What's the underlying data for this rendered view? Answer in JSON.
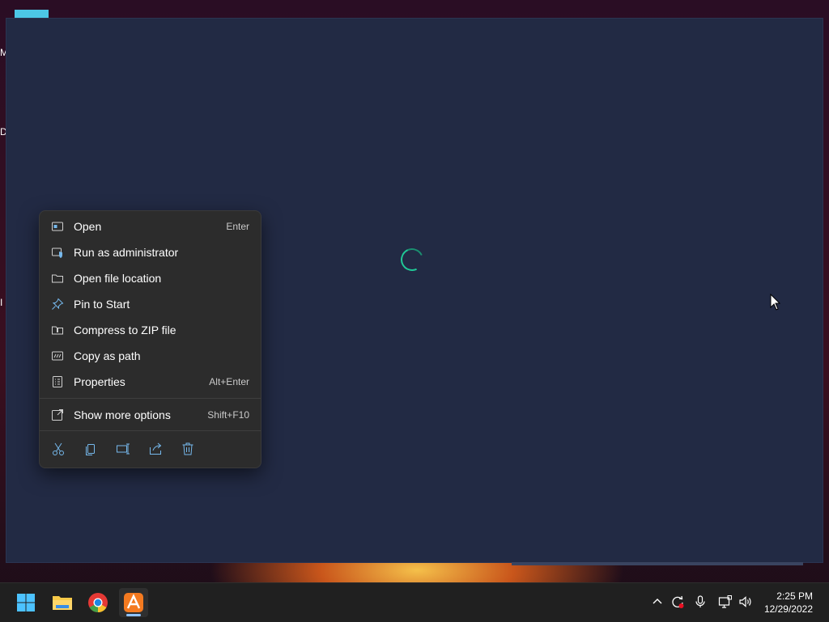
{
  "desktop": {
    "edge_labels": [
      "M",
      "D",
      "I"
    ]
  },
  "context_menu": {
    "items": [
      {
        "label": "Open",
        "shortcut": "Enter",
        "icon": "open-icon"
      },
      {
        "label": "Run as administrator",
        "shortcut": "",
        "icon": "shield-icon"
      },
      {
        "label": "Open file location",
        "shortcut": "",
        "icon": "folder-icon"
      },
      {
        "label": "Pin to Start",
        "shortcut": "",
        "icon": "pin-icon"
      },
      {
        "label": "Compress to ZIP file",
        "shortcut": "",
        "icon": "zip-icon"
      },
      {
        "label": "Copy as path",
        "shortcut": "",
        "icon": "path-icon"
      },
      {
        "label": "Properties",
        "shortcut": "Alt+Enter",
        "icon": "properties-icon"
      }
    ],
    "more_options": {
      "label": "Show more options",
      "shortcut": "Shift+F10",
      "icon": "more-options-icon"
    },
    "toolbar": [
      "cut-icon",
      "copy-icon",
      "rename-icon",
      "share-icon",
      "delete-icon"
    ]
  },
  "taskbar": {
    "apps": [
      "start-icon",
      "file-explorer-icon",
      "chrome-icon",
      "app-icon"
    ],
    "active_app": "app-icon",
    "tray_icons": [
      "chevron-up-icon",
      "sync-icon",
      "microphone-icon",
      "network-icon",
      "volume-icon"
    ],
    "time": "2:25 PM",
    "date": "12/29/2022"
  },
  "colors": {
    "window_bg": "#222a44",
    "menu_bg": "#2c2c2c",
    "accent": "#20c997",
    "icon_blue": "#76b9ed"
  }
}
